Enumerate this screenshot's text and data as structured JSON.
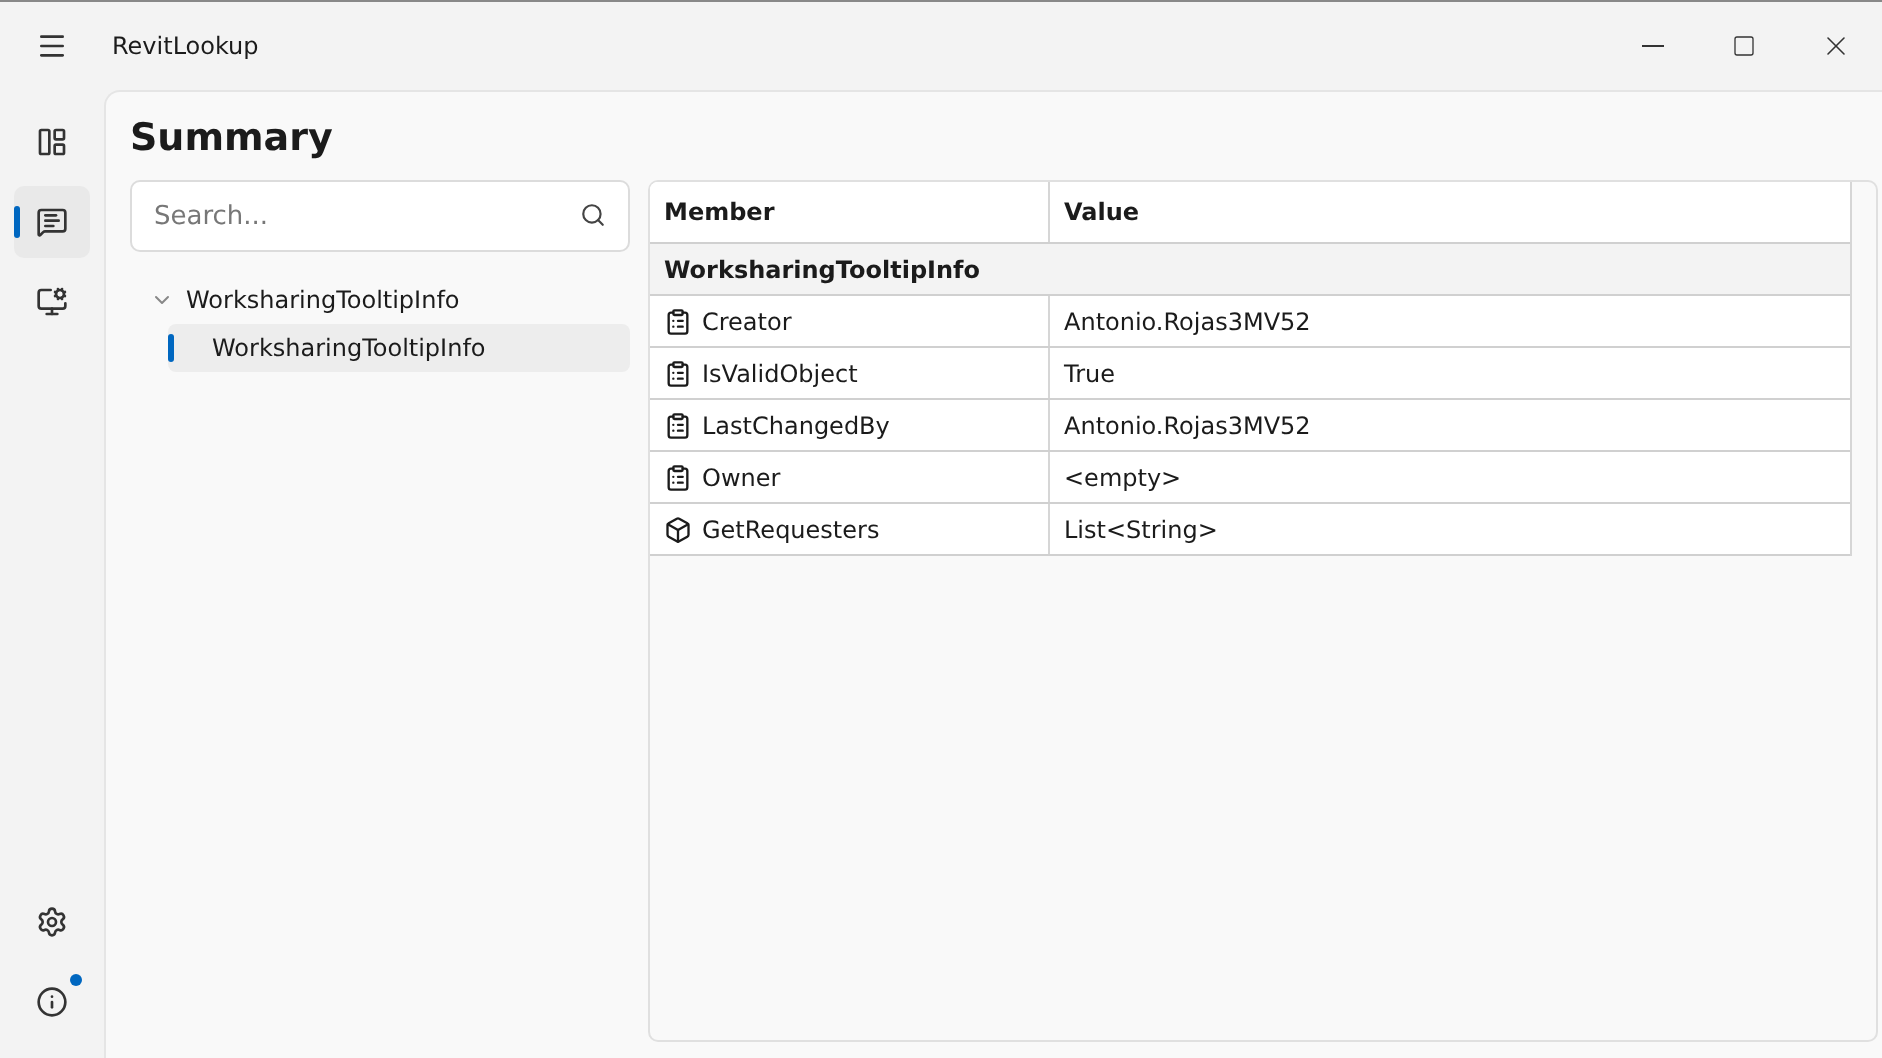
{
  "window": {
    "title": "RevitLookup"
  },
  "nav": [
    {
      "kind": "dashboard",
      "selected": false
    },
    {
      "kind": "snoop",
      "selected": true
    },
    {
      "kind": "monitor",
      "selected": false
    }
  ],
  "nav_footer": [
    {
      "kind": "settings",
      "badge": false
    },
    {
      "kind": "info",
      "badge": true
    }
  ],
  "page_title": "Summary",
  "search": {
    "placeholder": "Search..."
  },
  "tree": [
    {
      "label": "WorksharingTooltipInfo",
      "expanded": true,
      "selected": false,
      "children": [
        {
          "label": "WorksharingTooltipInfo",
          "selected": true
        }
      ]
    }
  ],
  "table": {
    "columns": [
      "Member",
      "Value"
    ],
    "group": "WorksharingTooltipInfo",
    "rows": [
      {
        "kind": "property",
        "member": "Creator",
        "value": "Antonio.Rojas3MV52"
      },
      {
        "kind": "property",
        "member": "IsValidObject",
        "value": "True"
      },
      {
        "kind": "property",
        "member": "LastChangedBy",
        "value": "Antonio.Rojas3MV52"
      },
      {
        "kind": "property",
        "member": "Owner",
        "value": "<empty>"
      },
      {
        "kind": "method",
        "member": "GetRequesters",
        "value": "List<String>"
      }
    ]
  }
}
